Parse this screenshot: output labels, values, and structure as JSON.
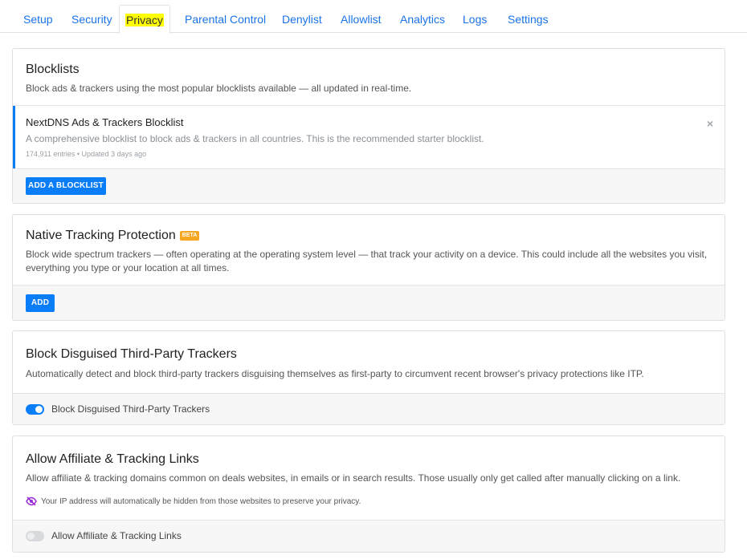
{
  "tabs": [
    {
      "label": "Setup"
    },
    {
      "label": "Security"
    },
    {
      "label": "Privacy"
    },
    {
      "label": "Parental Control"
    },
    {
      "label": "Denylist"
    },
    {
      "label": "Allowlist"
    },
    {
      "label": "Analytics"
    },
    {
      "label": "Logs"
    },
    {
      "label": "Settings"
    }
  ],
  "active_tab": "Privacy",
  "blocklists": {
    "title": "Blocklists",
    "description": "Block ads & trackers using the most popular blocklists available — all updated in real-time.",
    "items": [
      {
        "name": "NextDNS Ads & Trackers Blocklist",
        "description": "A comprehensive blocklist to block ads & trackers in all countries. This is the recommended starter blocklist.",
        "meta": "174,911 entries • Updated 3 days ago",
        "remove_icon": "×"
      }
    ],
    "add_button": "ADD A BLOCKLIST"
  },
  "native_tracking": {
    "title": "Native Tracking Protection",
    "badge": "BETA",
    "description": "Block wide spectrum trackers — often operating at the operating system level — that track your activity on a device. This could include all the websites you visit, everything you type or your location at all times.",
    "add_button": "ADD"
  },
  "disguised_trackers": {
    "title": "Block Disguised Third-Party Trackers",
    "description": "Automatically detect and block third-party trackers disguising themselves as first-party to circumvent recent browser's privacy protections like ITP.",
    "toggle_label": "Block Disguised Third-Party Trackers",
    "enabled": true
  },
  "affiliate_links": {
    "title": "Allow Affiliate & Tracking Links",
    "description": "Allow affiliate & tracking domains common on deals websites, in emails or in search results. Those usually only get called after manually clicking on a link.",
    "ip_note": "Your IP address will automatically be hidden from those websites to preserve your privacy.",
    "ip_note_icon": "eye-slash-icon",
    "toggle_label": "Allow Affiliate & Tracking Links",
    "enabled": false
  },
  "colors": {
    "accent": "#0a7df9",
    "tab_text": "#1a73e8",
    "beta_badge": "#f5a623",
    "highlight": "#ffff00",
    "privacy_icon": "#9b2bd6"
  }
}
